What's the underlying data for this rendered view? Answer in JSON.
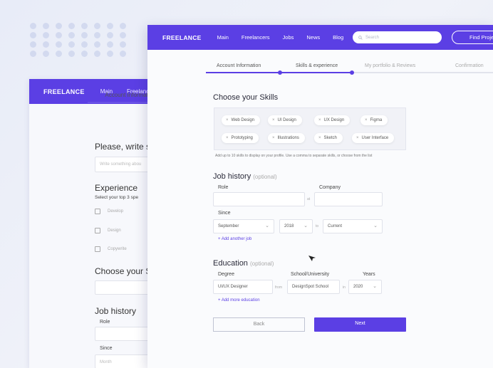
{
  "colors": {
    "brand": "#5b3fe4",
    "background": "#eceff8"
  },
  "back_window": {
    "logo": "FREELANCE",
    "nav": [
      "Main",
      "Freelancers"
    ],
    "tab": "Account Information",
    "heading1": "Please, write s",
    "input1_placeholder": "Write something abou",
    "heading2": "Experience",
    "sub2": "Select your top 3 spe",
    "checks": [
      "Develop",
      "Design",
      "Copywrite"
    ],
    "heading3": "Choose your S",
    "heading4": "Job history",
    "role_label": "Role",
    "since_label": "Since",
    "since_value": "Month"
  },
  "nav": {
    "logo": "FREELANCE",
    "links": [
      "Main",
      "Freelancers",
      "Jobs",
      "News",
      "Blog"
    ],
    "search_placeholder": "Search",
    "find_button": "Find Proje"
  },
  "steps": [
    "Account Information",
    "Skills & experience",
    "My portfolio & Reviews",
    "Confirmation"
  ],
  "skills": {
    "title": "Choose your Skills",
    "chips": [
      "Web Design",
      "UI Design",
      "UX Design",
      "Figma",
      "Prototyping",
      "Illustrations",
      "Sketch",
      "User Interface"
    ],
    "hint": "Add up to 10 skills to display on your profile. Use a comma to separate skills, or choose from the list"
  },
  "job_history": {
    "title": "Job history",
    "optional": "(optional)",
    "role_label": "Role",
    "company_label": "Company",
    "at": "at",
    "since_label": "Since",
    "month": "September",
    "year": "2018",
    "to": "to",
    "until": "Current",
    "add_link": "+ Add another job"
  },
  "education": {
    "title": "Education",
    "optional": "(optional)",
    "degree_label": "Degree",
    "school_label": "School/University",
    "years_label": "Years",
    "degree": "UI/UX Designer",
    "from": "from",
    "school": "DesignSpot School",
    "in": "in",
    "year": "2020",
    "add_link": "+ Add more education"
  },
  "buttons": {
    "back": "Back",
    "next": "Next"
  }
}
